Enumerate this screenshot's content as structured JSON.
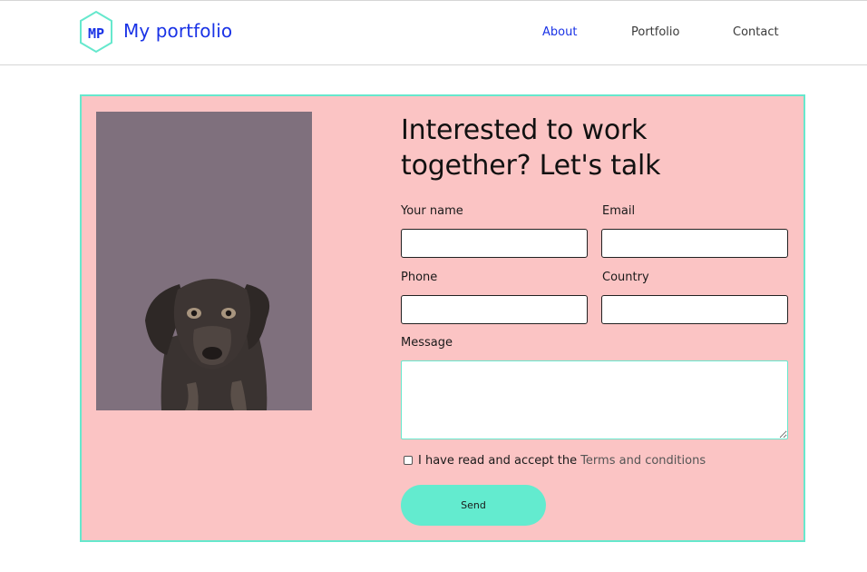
{
  "brand": {
    "logo_text": "MP",
    "title": "My portfolio",
    "colors": {
      "brand": "#1a33e6",
      "accent": "#66e8cd"
    }
  },
  "nav": {
    "items": [
      {
        "label": "About",
        "active": true
      },
      {
        "label": "Portfolio",
        "active": false
      },
      {
        "label": "Contact",
        "active": false
      }
    ]
  },
  "contact": {
    "heading": "Interested to work together? Let's talk",
    "image": "puppy-photo",
    "fields": {
      "name": {
        "label": "Your name",
        "value": "",
        "placeholder": ""
      },
      "email": {
        "label": "Email",
        "value": "",
        "placeholder": ""
      },
      "phone": {
        "label": "Phone",
        "value": "",
        "placeholder": ""
      },
      "country": {
        "label": "Country",
        "value": "",
        "placeholder": ""
      },
      "message": {
        "label": "Message",
        "value": "",
        "placeholder": ""
      }
    },
    "terms": {
      "checked": false,
      "text": "I have read and accept the ",
      "link": "Terms and conditions"
    },
    "send_label": "Send",
    "colors": {
      "panel_bg": "#fbc4c4",
      "button": "#63ebcf",
      "photo_bg": "#7f707d"
    }
  }
}
